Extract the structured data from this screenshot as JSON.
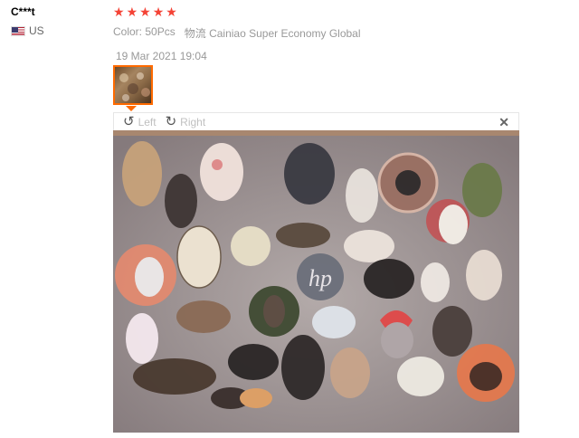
{
  "reviewer": {
    "name": "C***t",
    "country": "US"
  },
  "review": {
    "rating": 5,
    "stars": [
      "★",
      "★",
      "★",
      "★",
      "★"
    ],
    "color_label": "Color:",
    "color_value": "50Pcs",
    "shipping_label": "物流",
    "shipping_value": "Cainiao Super Economy Global",
    "date": "19 Mar 2021 19:04"
  },
  "viewer": {
    "rotate_left_label": "Left",
    "rotate_right_label": "Right",
    "rotate_left_icon": "rotate-left-icon",
    "rotate_right_icon": "rotate-right-icon",
    "close_icon": "close-icon",
    "photo_logo_text": "hp"
  },
  "colors": {
    "star": "#f44336",
    "thumb_border": "#ff6a00",
    "muted_text": "#999999"
  }
}
